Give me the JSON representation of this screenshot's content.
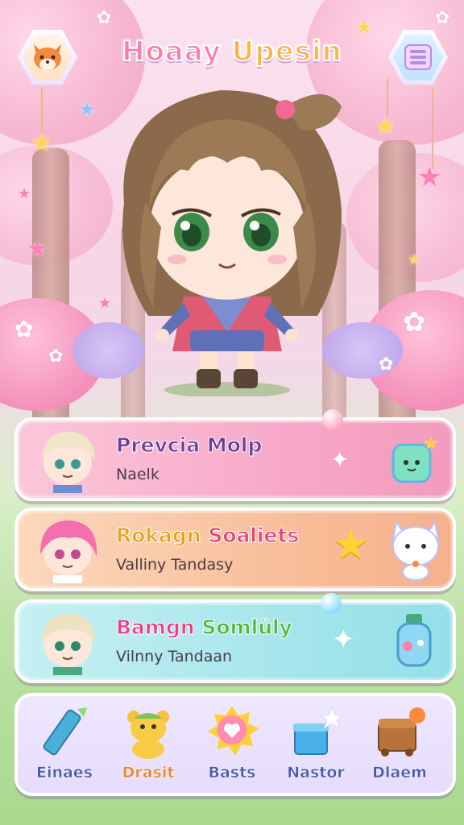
{
  "header": {
    "title_part1": "Hoaay",
    "title_part2": "Upesin",
    "left_button_icon": "fox-profile-icon",
    "right_button_icon": "menu-icon"
  },
  "character_list": [
    {
      "name": "Prevcia Molp",
      "subtitle": "Naelk",
      "accent": "#f7a9c8"
    },
    {
      "name_part1": "Rokagn",
      "name_part2": "Soaliets",
      "subtitle": "Valliny Tandasy",
      "accent": "#f8bf9a"
    },
    {
      "name_part1": "Bamgn",
      "name_part2": "Somlüly",
      "subtitle": "Vilnny Tandaan",
      "accent": "#a6e6ec"
    }
  ],
  "bottom_nav": [
    {
      "label": "Einaes",
      "icon": "crayon-icon"
    },
    {
      "label": "Drasit",
      "icon": "teddy-bear-icon"
    },
    {
      "label": "Basts",
      "icon": "heart-badge-icon"
    },
    {
      "label": "Nastor",
      "icon": "gift-box-icon"
    },
    {
      "label": "Dlaem",
      "icon": "treasure-chest-icon"
    }
  ],
  "colors": {
    "pink_accent": "#ff7aa6",
    "orange_accent": "#ffb347",
    "nav_label": "#4a5aa8"
  }
}
